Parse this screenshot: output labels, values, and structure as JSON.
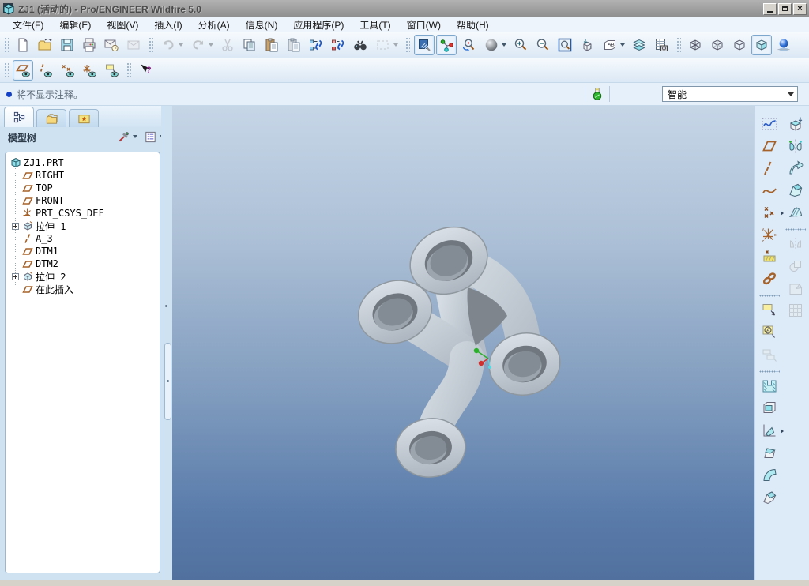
{
  "window": {
    "title": "ZJ1 (活动的) - Pro/ENGINEER Wildfire 5.0",
    "controls": [
      {
        "name": "minimize"
      },
      {
        "name": "restore"
      },
      {
        "name": "close"
      }
    ]
  },
  "menubar": {
    "items": [
      {
        "label": "文件(F)"
      },
      {
        "label": "编辑(E)"
      },
      {
        "label": "视图(V)"
      },
      {
        "label": "插入(I)"
      },
      {
        "label": "分析(A)"
      },
      {
        "label": "信息(N)"
      },
      {
        "label": "应用程序(P)"
      },
      {
        "label": "工具(T)"
      },
      {
        "label": "窗口(W)"
      },
      {
        "label": "帮助(H)"
      }
    ]
  },
  "toolbar_main": {
    "items": [
      {
        "type": "grip"
      },
      {
        "name": "new-file",
        "icon": "new-file"
      },
      {
        "name": "open-file",
        "icon": "open-folder"
      },
      {
        "name": "save-file",
        "icon": "save-floppy"
      },
      {
        "name": "print",
        "icon": "printer"
      },
      {
        "name": "send-email",
        "icon": "mail-clock"
      },
      {
        "name": "email-link",
        "icon": "mail-plain",
        "disabled": true
      },
      {
        "type": "grip"
      },
      {
        "name": "undo",
        "icon": "undo-arrow",
        "dropdown": true,
        "disabled": true
      },
      {
        "name": "redo",
        "icon": "redo-arrow",
        "dropdown": true,
        "disabled": true
      },
      {
        "name": "cut",
        "icon": "scissors",
        "disabled": true
      },
      {
        "name": "copy",
        "icon": "copy-docs"
      },
      {
        "name": "paste",
        "icon": "clipboard-paste"
      },
      {
        "name": "paste-special",
        "icon": "clipboard-special"
      },
      {
        "name": "regenerate",
        "icon": "regenerate-blue"
      },
      {
        "name": "regenerate-manager",
        "icon": "regenerate-red"
      },
      {
        "name": "find",
        "icon": "binoculars"
      },
      {
        "name": "selection-box",
        "icon": "dashed-rect",
        "dropdown": true,
        "disabled": true
      },
      {
        "type": "grip"
      },
      {
        "name": "repaint",
        "icon": "repaint-view",
        "pressed": true
      },
      {
        "name": "spin-center",
        "icon": "spin-center",
        "pressed": true
      },
      {
        "name": "orient-mode",
        "icon": "orient-mode"
      },
      {
        "name": "appearance",
        "icon": "appearance-sphere",
        "dropdown": true
      },
      {
        "name": "zoom-in",
        "icon": "zoom-in"
      },
      {
        "name": "zoom-out",
        "icon": "zoom-out"
      },
      {
        "name": "refit",
        "icon": "refit"
      },
      {
        "name": "reorient",
        "icon": "reorient-view"
      },
      {
        "name": "saved-views",
        "icon": "saved-view-list",
        "dropdown": true
      },
      {
        "name": "layers",
        "icon": "layers"
      },
      {
        "name": "view-manager",
        "icon": "view-manager"
      },
      {
        "type": "grip"
      },
      {
        "name": "wireframe",
        "icon": "cube-wireframe"
      },
      {
        "name": "hidden-line",
        "icon": "cube-hiddenline"
      },
      {
        "name": "no-hidden",
        "icon": "cube-nohidden"
      },
      {
        "name": "shaded",
        "icon": "cube-shaded",
        "pressed": true
      },
      {
        "name": "enhanced-realism",
        "icon": "realism-ball"
      }
    ]
  },
  "toolbar_datum": {
    "items": [
      {
        "type": "grip"
      },
      {
        "name": "plane-display",
        "icon": "plane-eye",
        "pressed": true
      },
      {
        "name": "axis-display",
        "icon": "axis-eye"
      },
      {
        "name": "point-display",
        "icon": "point-eye"
      },
      {
        "name": "csys-display",
        "icon": "csys-eye"
      },
      {
        "name": "annotation-display",
        "icon": "note-eye"
      },
      {
        "type": "grip"
      },
      {
        "name": "context-help",
        "icon": "help-select"
      }
    ]
  },
  "message_bar": {
    "text": "将不显示注释。",
    "status_icon": "regeneration-status",
    "filter": {
      "value": "智能"
    }
  },
  "navigator": {
    "tabs": [
      {
        "name": "model-tree-tab",
        "icon": "tab-tree",
        "active": true
      },
      {
        "name": "folder-browser-tab",
        "icon": "tab-folders",
        "active": false
      },
      {
        "name": "favorites-tab",
        "icon": "tab-favorites",
        "active": false
      }
    ],
    "header": {
      "title": "模型树",
      "buttons": [
        {
          "name": "tree-tools",
          "icon": "tools",
          "dropdown": true
        },
        {
          "name": "tree-settings",
          "icon": "list-settings",
          "dropdown": true
        }
      ]
    },
    "tree": {
      "items": [
        {
          "label": "ZJ1.PRT",
          "icon": "part",
          "root": true
        },
        {
          "label": "RIGHT",
          "icon": "plane"
        },
        {
          "label": "TOP",
          "icon": "plane"
        },
        {
          "label": "FRONT",
          "icon": "plane"
        },
        {
          "label": "PRT_CSYS_DEF",
          "icon": "csys"
        },
        {
          "label": "拉伸 1",
          "icon": "extrude",
          "expandable": true
        },
        {
          "label": "A_3",
          "icon": "axis"
        },
        {
          "label": "DTM1",
          "icon": "plane"
        },
        {
          "label": "DTM2",
          "icon": "plane"
        },
        {
          "label": "拉伸 2",
          "icon": "extrude",
          "expandable": true
        },
        {
          "label": "在此插入",
          "icon": "insert-here"
        }
      ]
    }
  },
  "right_toolbar": {
    "col1": [
      {
        "name": "sketch-tool",
        "icon": "sketch"
      },
      {
        "name": "datum-plane-tool",
        "icon": "datum-plane"
      },
      {
        "name": "datum-axis-tool",
        "icon": "datum-axis"
      },
      {
        "name": "datum-curve-tool",
        "icon": "datum-curve"
      },
      {
        "name": "datum-point-tool",
        "icon": "datum-point",
        "flyout": true
      },
      {
        "name": "datum-csys-tool",
        "icon": "datum-csys"
      },
      {
        "name": "analysis-tool",
        "icon": "analysis-hatch"
      },
      {
        "name": "copy-geometry-tool",
        "icon": "chain-link"
      },
      {
        "type": "sep"
      },
      {
        "name": "note-tool",
        "icon": "note-leader"
      },
      {
        "name": "datum-target-tool",
        "icon": "target-a"
      },
      {
        "name": "annotation-plane-tool",
        "icon": "annotation-planes",
        "disabled": true
      },
      {
        "type": "sep"
      },
      {
        "name": "hole-tool",
        "icon": "hole"
      },
      {
        "name": "shell-tool",
        "icon": "shell"
      },
      {
        "name": "rib-tool",
        "icon": "rib",
        "flyout": true
      },
      {
        "name": "draft-tool",
        "icon": "draft"
      },
      {
        "name": "round-tool",
        "icon": "round"
      },
      {
        "name": "chamfer-tool",
        "icon": "chamfer"
      }
    ],
    "col2": [
      {
        "name": "extrude-tool",
        "icon": "extrude"
      },
      {
        "name": "revolve-tool",
        "icon": "revolve"
      },
      {
        "name": "sweep-tool",
        "icon": "sweep"
      },
      {
        "name": "blend-tool",
        "icon": "blend"
      },
      {
        "name": "boundary-blend-tool",
        "icon": "boundary-blend"
      },
      {
        "type": "sep"
      },
      {
        "name": "mirror-tool",
        "icon": "mirror",
        "disabled": true
      },
      {
        "name": "merge-tool",
        "icon": "merge",
        "disabled": true
      },
      {
        "name": "extend-tool",
        "icon": "extend",
        "disabled": true
      },
      {
        "name": "pattern-tool",
        "icon": "pattern",
        "disabled": true
      }
    ]
  },
  "viewport": {
    "background_top": "#c6d6e7",
    "background_bottom": "#51709e",
    "part_color": "#c9d0d8",
    "spin_center_colors": {
      "x": "#d03030",
      "y": "#2ab02a",
      "z": "#58d8e0"
    }
  },
  "colors": {
    "titlebar": "#9d9d9d",
    "toolbar": "#e4eef8",
    "pressed_border": "#7da7cd",
    "message_bullet": "#1240c8"
  }
}
